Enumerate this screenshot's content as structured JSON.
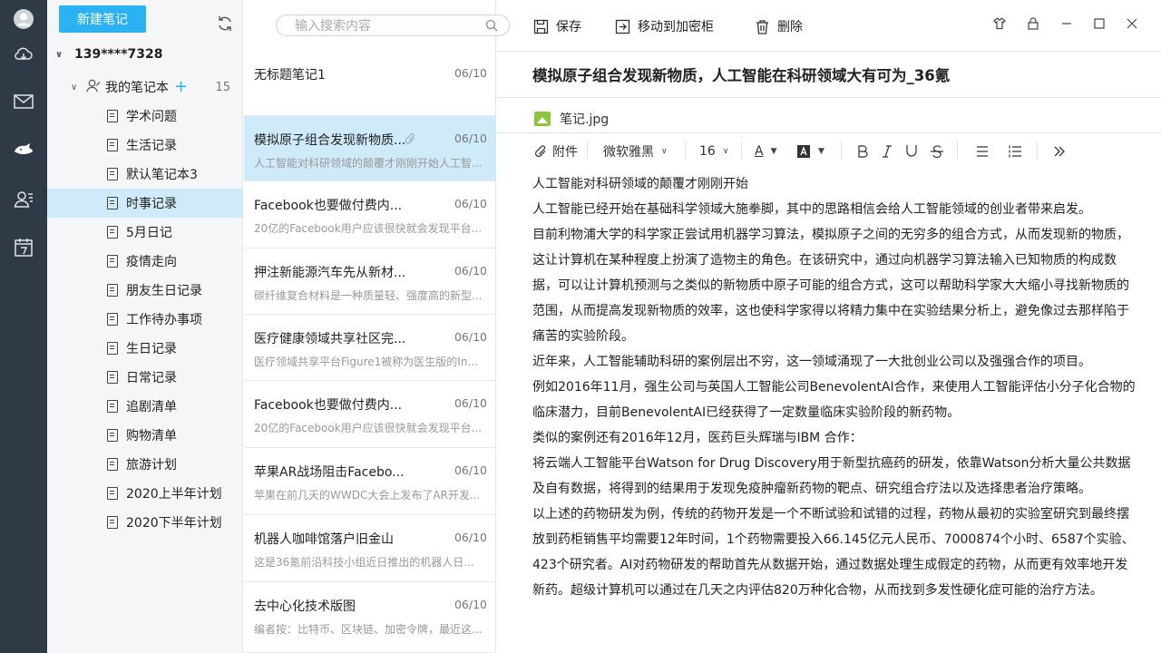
{
  "tree": {
    "new_note": "新建笔记",
    "account": "139****7328",
    "root_label": "我的笔记本",
    "root_count": "15",
    "notebooks": [
      {
        "label": "学术问题"
      },
      {
        "label": "生活记录"
      },
      {
        "label": "默认笔记本3"
      },
      {
        "label": "时事记录",
        "active": true
      },
      {
        "label": "5月日记"
      },
      {
        "label": "疫情走向"
      },
      {
        "label": "朋友生日记录"
      },
      {
        "label": "工作待办事项"
      },
      {
        "label": "生日记录"
      },
      {
        "label": "日常记录"
      },
      {
        "label": "追剧清单"
      },
      {
        "label": "购物清单"
      },
      {
        "label": "旅游计划"
      },
      {
        "label": "2020上半年计划"
      },
      {
        "label": "2020下半年计划"
      }
    ]
  },
  "search": {
    "placeholder": "输入搜索内容"
  },
  "notes": [
    {
      "title": "无标题笔记1",
      "date": "06/10",
      "snippet": ""
    },
    {
      "title": "模拟原子组合发现新物质...",
      "date": "06/10",
      "snippet": "人工智能对科研领域的颠覆才刚刚开始人工智...",
      "active": true,
      "attachment": true
    },
    {
      "title": "Facebook也要做付费内...",
      "date": "06/10",
      "snippet": "20亿的Facebook用户应该很快就会发现平台..."
    },
    {
      "title": "押注新能源汽车先从新材...",
      "date": "06/10",
      "snippet": "碳纤维复合材料是一种质量轻、强度高的新型..."
    },
    {
      "title": "医疗健康领域共享社区完...",
      "date": "06/10",
      "snippet": "医疗领域共享平台Figure1被称为医生版的Ins..."
    },
    {
      "title": "Facebook也要做付费内...",
      "date": "06/10",
      "snippet": "20亿的Facebook用户应该很快就会发现平台..."
    },
    {
      "title": "苹果AR战场阻击Facebo...",
      "date": "06/10",
      "snippet": "苹果在前几天的WWDC大会上发布了AR开发..."
    },
    {
      "title": "机器人咖啡馆落户旧金山",
      "date": "06/10",
      "snippet": "这是36氪前沿科技小组近日推出的机器人日..."
    },
    {
      "title": "去中心化技术版图",
      "date": "06/10",
      "snippet": "编者按：比特币、区块链、加密令牌，最近这..."
    }
  ],
  "toolbar": {
    "save": "保存",
    "move": "移动到加密柜",
    "delete": "删除"
  },
  "editor": {
    "title": "模拟原子组合发现新物质，人工智能在科研领域大有可为_36氪",
    "attachment_name": "笔记.jpg",
    "attach_label": "附件",
    "font_family": "微软雅黑",
    "font_size": "16",
    "font_color_label": "A",
    "paragraphs": [
      "人工智能对科研领域的颠覆才刚刚开始",
      "人工智能已经开始在基础科学领域大施拳脚，其中的思路相信会给人工智能领域的创业者带来启发。",
      "目前利物浦大学的科学家正尝试用机器学习算法，模拟原子之间的无穷多的组合方式，从而发现新的物质，这让计算机在某种程度上扮演了造物主的角色。在该研究中，通过向机器学习算法输入已知物质的构成数据，可以让计算机预测与之类似的新物质中原子可能的组合方式，这可以帮助科学家大大缩小寻找新物质的范围，从而提高发现新物质的效率，这也使科学家得以将精力集中在实验结果分析上，避免像过去那样陷于痛苦的实验阶段。",
      "近年来，人工智能辅助科研的案例层出不穷，这一领域涌现了一大批创业公司以及强强合作的项目。",
      "例如2016年11月，强生公司与英国人工智能公司BenevolentAI合作，来使用人工智能评估小分子化合物的临床潜力，目前BenevolentAI已经获得了一定数量临床实验阶段的新药物。",
      "类似的案例还有2016年12月，医药巨头辉瑞与IBM 合作：",
      "将云端人工智能平台Watson for Drug Discovery用于新型抗癌药的研发，依靠Watson分析大量公共数据及自有数据，将得到的结果用于发现免疫肿瘤新药物的靶点、研究组合疗法以及选择患者治疗策略。",
      "以上述的药物研发为例，传统的药物开发是一个不断试验和试错的过程，药物从最初的实验室研究到最终摆放到药柜销售平均需要12年时间，1个药物需要投入66.145亿元人民币、7000874个小时、6587个实验、423个研究者。AI对药物研发的帮助首先从数据开始，通过数据处理生成假定的药物，从而更有效率地开发新药。超级计算机可以通过在几天之内评估820万种化合物，从而找到多发性硬化症可能的治疗方法。"
    ]
  },
  "colors": {
    "accent": "#2cb2f2",
    "rail": "#2f3a46",
    "selected": "#cfeaf8"
  }
}
